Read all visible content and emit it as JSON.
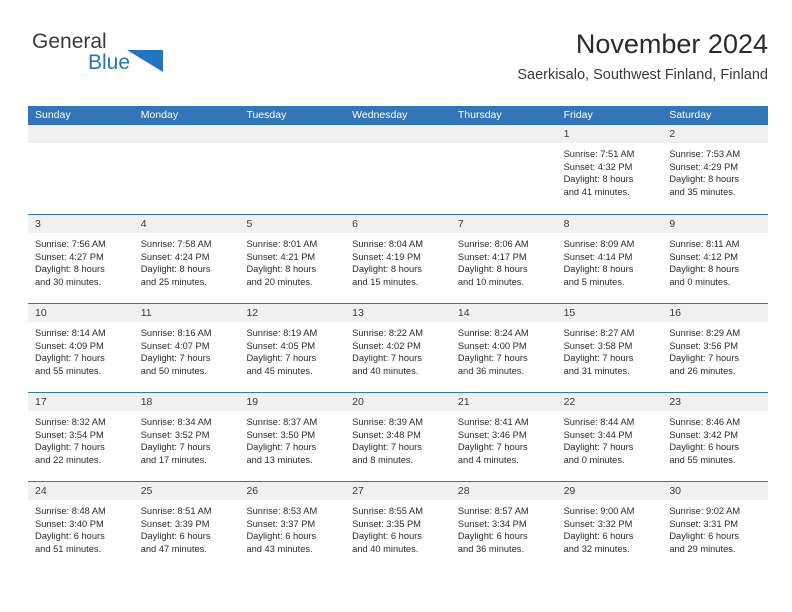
{
  "brand": {
    "name_part1": "General",
    "name_part2": "Blue",
    "triangle_color": "#2175c0"
  },
  "header": {
    "title": "November 2024",
    "subtitle": "Saerkisalo, Southwest Finland, Finland"
  },
  "colors": {
    "header_blue": "#3275b8",
    "day_strip_gray": "#f0f0f0",
    "text": "#2b2b2b"
  },
  "weekdays": [
    "Sunday",
    "Monday",
    "Tuesday",
    "Wednesday",
    "Thursday",
    "Friday",
    "Saturday"
  ],
  "weeks": [
    [
      {
        "day": "",
        "sunrise": "",
        "sunset": "",
        "daylight_line1": "",
        "daylight_line2": "",
        "empty": true
      },
      {
        "day": "",
        "sunrise": "",
        "sunset": "",
        "daylight_line1": "",
        "daylight_line2": "",
        "empty": true
      },
      {
        "day": "",
        "sunrise": "",
        "sunset": "",
        "daylight_line1": "",
        "daylight_line2": "",
        "empty": true
      },
      {
        "day": "",
        "sunrise": "",
        "sunset": "",
        "daylight_line1": "",
        "daylight_line2": "",
        "empty": true
      },
      {
        "day": "",
        "sunrise": "",
        "sunset": "",
        "daylight_line1": "",
        "daylight_line2": "",
        "empty": true
      },
      {
        "day": "1",
        "sunrise": "Sunrise: 7:51 AM",
        "sunset": "Sunset: 4:32 PM",
        "daylight_line1": "Daylight: 8 hours",
        "daylight_line2": "and 41 minutes.",
        "empty": false
      },
      {
        "day": "2",
        "sunrise": "Sunrise: 7:53 AM",
        "sunset": "Sunset: 4:29 PM",
        "daylight_line1": "Daylight: 8 hours",
        "daylight_line2": "and 35 minutes.",
        "empty": false
      }
    ],
    [
      {
        "day": "3",
        "sunrise": "Sunrise: 7:56 AM",
        "sunset": "Sunset: 4:27 PM",
        "daylight_line1": "Daylight: 8 hours",
        "daylight_line2": "and 30 minutes.",
        "empty": false
      },
      {
        "day": "4",
        "sunrise": "Sunrise: 7:58 AM",
        "sunset": "Sunset: 4:24 PM",
        "daylight_line1": "Daylight: 8 hours",
        "daylight_line2": "and 25 minutes.",
        "empty": false
      },
      {
        "day": "5",
        "sunrise": "Sunrise: 8:01 AM",
        "sunset": "Sunset: 4:21 PM",
        "daylight_line1": "Daylight: 8 hours",
        "daylight_line2": "and 20 minutes.",
        "empty": false
      },
      {
        "day": "6",
        "sunrise": "Sunrise: 8:04 AM",
        "sunset": "Sunset: 4:19 PM",
        "daylight_line1": "Daylight: 8 hours",
        "daylight_line2": "and 15 minutes.",
        "empty": false
      },
      {
        "day": "7",
        "sunrise": "Sunrise: 8:06 AM",
        "sunset": "Sunset: 4:17 PM",
        "daylight_line1": "Daylight: 8 hours",
        "daylight_line2": "and 10 minutes.",
        "empty": false
      },
      {
        "day": "8",
        "sunrise": "Sunrise: 8:09 AM",
        "sunset": "Sunset: 4:14 PM",
        "daylight_line1": "Daylight: 8 hours",
        "daylight_line2": "and 5 minutes.",
        "empty": false
      },
      {
        "day": "9",
        "sunrise": "Sunrise: 8:11 AM",
        "sunset": "Sunset: 4:12 PM",
        "daylight_line1": "Daylight: 8 hours",
        "daylight_line2": "and 0 minutes.",
        "empty": false
      }
    ],
    [
      {
        "day": "10",
        "sunrise": "Sunrise: 8:14 AM",
        "sunset": "Sunset: 4:09 PM",
        "daylight_line1": "Daylight: 7 hours",
        "daylight_line2": "and 55 minutes.",
        "empty": false
      },
      {
        "day": "11",
        "sunrise": "Sunrise: 8:16 AM",
        "sunset": "Sunset: 4:07 PM",
        "daylight_line1": "Daylight: 7 hours",
        "daylight_line2": "and 50 minutes.",
        "empty": false
      },
      {
        "day": "12",
        "sunrise": "Sunrise: 8:19 AM",
        "sunset": "Sunset: 4:05 PM",
        "daylight_line1": "Daylight: 7 hours",
        "daylight_line2": "and 45 minutes.",
        "empty": false
      },
      {
        "day": "13",
        "sunrise": "Sunrise: 8:22 AM",
        "sunset": "Sunset: 4:02 PM",
        "daylight_line1": "Daylight: 7 hours",
        "daylight_line2": "and 40 minutes.",
        "empty": false
      },
      {
        "day": "14",
        "sunrise": "Sunrise: 8:24 AM",
        "sunset": "Sunset: 4:00 PM",
        "daylight_line1": "Daylight: 7 hours",
        "daylight_line2": "and 36 minutes.",
        "empty": false
      },
      {
        "day": "15",
        "sunrise": "Sunrise: 8:27 AM",
        "sunset": "Sunset: 3:58 PM",
        "daylight_line1": "Daylight: 7 hours",
        "daylight_line2": "and 31 minutes.",
        "empty": false
      },
      {
        "day": "16",
        "sunrise": "Sunrise: 8:29 AM",
        "sunset": "Sunset: 3:56 PM",
        "daylight_line1": "Daylight: 7 hours",
        "daylight_line2": "and 26 minutes.",
        "empty": false
      }
    ],
    [
      {
        "day": "17",
        "sunrise": "Sunrise: 8:32 AM",
        "sunset": "Sunset: 3:54 PM",
        "daylight_line1": "Daylight: 7 hours",
        "daylight_line2": "and 22 minutes.",
        "empty": false
      },
      {
        "day": "18",
        "sunrise": "Sunrise: 8:34 AM",
        "sunset": "Sunset: 3:52 PM",
        "daylight_line1": "Daylight: 7 hours",
        "daylight_line2": "and 17 minutes.",
        "empty": false
      },
      {
        "day": "19",
        "sunrise": "Sunrise: 8:37 AM",
        "sunset": "Sunset: 3:50 PM",
        "daylight_line1": "Daylight: 7 hours",
        "daylight_line2": "and 13 minutes.",
        "empty": false
      },
      {
        "day": "20",
        "sunrise": "Sunrise: 8:39 AM",
        "sunset": "Sunset: 3:48 PM",
        "daylight_line1": "Daylight: 7 hours",
        "daylight_line2": "and 8 minutes.",
        "empty": false
      },
      {
        "day": "21",
        "sunrise": "Sunrise: 8:41 AM",
        "sunset": "Sunset: 3:46 PM",
        "daylight_line1": "Daylight: 7 hours",
        "daylight_line2": "and 4 minutes.",
        "empty": false
      },
      {
        "day": "22",
        "sunrise": "Sunrise: 8:44 AM",
        "sunset": "Sunset: 3:44 PM",
        "daylight_line1": "Daylight: 7 hours",
        "daylight_line2": "and 0 minutes.",
        "empty": false
      },
      {
        "day": "23",
        "sunrise": "Sunrise: 8:46 AM",
        "sunset": "Sunset: 3:42 PM",
        "daylight_line1": "Daylight: 6 hours",
        "daylight_line2": "and 55 minutes.",
        "empty": false
      }
    ],
    [
      {
        "day": "24",
        "sunrise": "Sunrise: 8:48 AM",
        "sunset": "Sunset: 3:40 PM",
        "daylight_line1": "Daylight: 6 hours",
        "daylight_line2": "and 51 minutes.",
        "empty": false
      },
      {
        "day": "25",
        "sunrise": "Sunrise: 8:51 AM",
        "sunset": "Sunset: 3:39 PM",
        "daylight_line1": "Daylight: 6 hours",
        "daylight_line2": "and 47 minutes.",
        "empty": false
      },
      {
        "day": "26",
        "sunrise": "Sunrise: 8:53 AM",
        "sunset": "Sunset: 3:37 PM",
        "daylight_line1": "Daylight: 6 hours",
        "daylight_line2": "and 43 minutes.",
        "empty": false
      },
      {
        "day": "27",
        "sunrise": "Sunrise: 8:55 AM",
        "sunset": "Sunset: 3:35 PM",
        "daylight_line1": "Daylight: 6 hours",
        "daylight_line2": "and 40 minutes.",
        "empty": false
      },
      {
        "day": "28",
        "sunrise": "Sunrise: 8:57 AM",
        "sunset": "Sunset: 3:34 PM",
        "daylight_line1": "Daylight: 6 hours",
        "daylight_line2": "and 36 minutes.",
        "empty": false
      },
      {
        "day": "29",
        "sunrise": "Sunrise: 9:00 AM",
        "sunset": "Sunset: 3:32 PM",
        "daylight_line1": "Daylight: 6 hours",
        "daylight_line2": "and 32 minutes.",
        "empty": false
      },
      {
        "day": "30",
        "sunrise": "Sunrise: 9:02 AM",
        "sunset": "Sunset: 3:31 PM",
        "daylight_line1": "Daylight: 6 hours",
        "daylight_line2": "and 29 minutes.",
        "empty": false
      }
    ]
  ]
}
